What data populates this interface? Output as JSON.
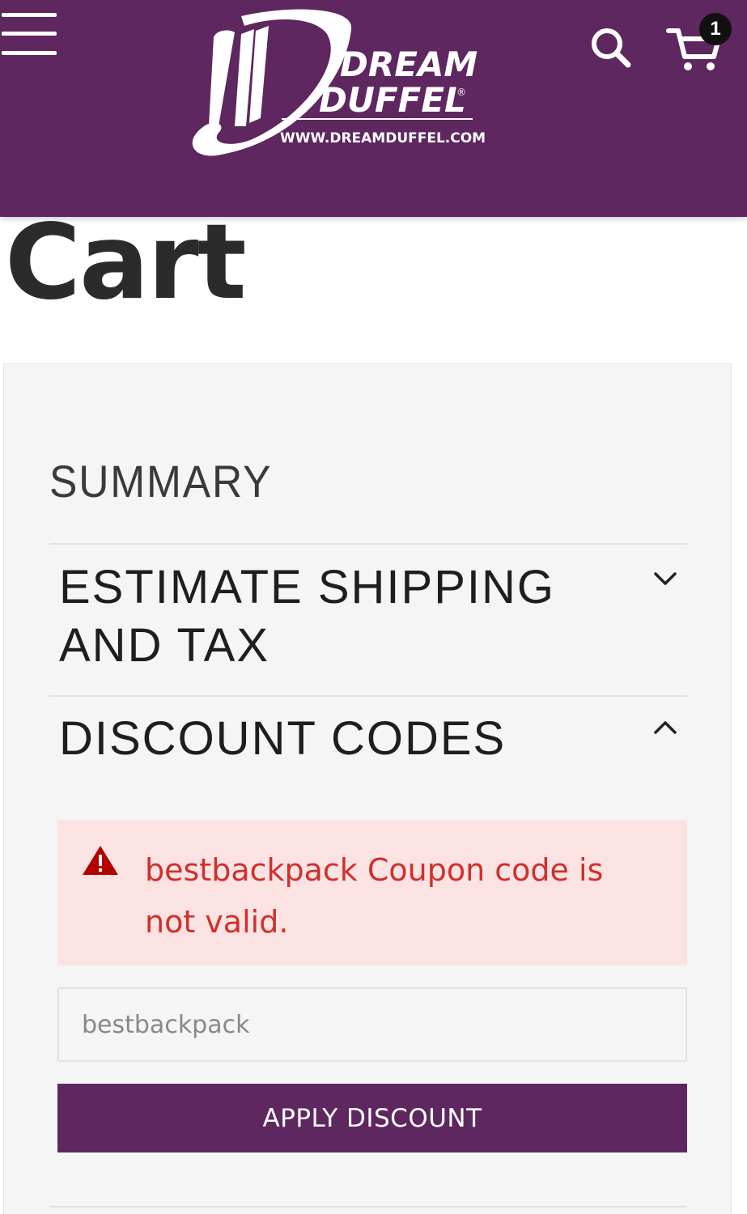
{
  "header": {
    "brand_line1": "DREAM",
    "brand_line2": "DUFFEL",
    "brand_registered": "®",
    "brand_url": "WWW.DREAMDUFFEL.COM",
    "cart_count": "1",
    "colors": {
      "header_bg": "#5e2760",
      "icon": "#ffffff"
    },
    "icons": [
      "hamburger-menu-icon",
      "search-icon",
      "cart-icon"
    ]
  },
  "page": {
    "title": "Cart"
  },
  "summary": {
    "title": "SUMMARY",
    "sections": [
      {
        "label": "ESTIMATE SHIPPING AND TAX",
        "expanded": false,
        "icon": "chevron-down-icon"
      },
      {
        "label": "DISCOUNT CODES",
        "expanded": true,
        "icon": "chevron-up-icon"
      }
    ],
    "discount": {
      "error_text": "bestbackpack Coupon code is not valid.",
      "error_icon": "warning-icon",
      "error_color": "#d0302c",
      "input_value": "bestbackpack",
      "apply_label": "APPLY DISCOUNT",
      "apply_color": "#5e2760"
    }
  }
}
